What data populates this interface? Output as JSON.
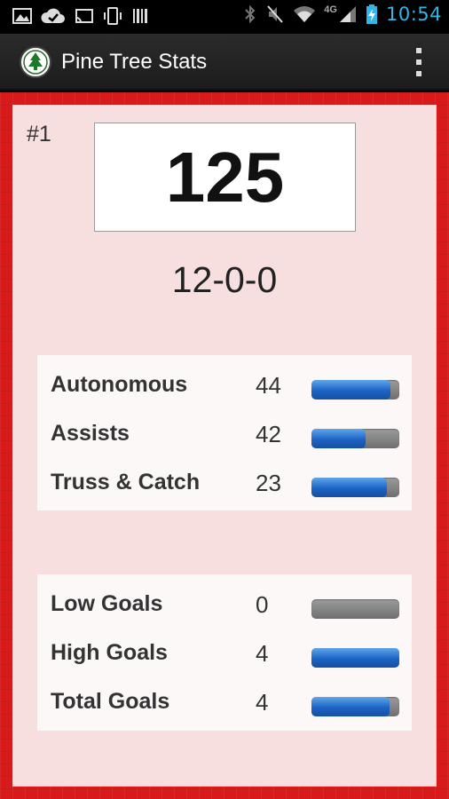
{
  "status_bar": {
    "time": "10:54",
    "network_label": "4G"
  },
  "app": {
    "title": "Pine Tree Stats"
  },
  "team": {
    "rank": "#1",
    "number": "125",
    "record": "12-0-0"
  },
  "stats_primary": [
    {
      "label": "Autonomous",
      "value": "44",
      "fill_fraction": 0.9
    },
    {
      "label": "Assists",
      "value": "42",
      "fill_fraction": 0.62
    },
    {
      "label": "Truss & Catch",
      "value": "23",
      "fill_fraction": 0.86
    }
  ],
  "stats_goals": [
    {
      "label": "Low Goals",
      "value": "0",
      "fill_fraction": 0.0
    },
    {
      "label": "High Goals",
      "value": "4",
      "fill_fraction": 1.0
    },
    {
      "label": "Total Goals",
      "value": "4",
      "fill_fraction": 0.89
    }
  ],
  "colors": {
    "accent_blue": "#1d63c4",
    "background_red": "#d81a1a",
    "card_pink": "#f7dfe0",
    "clock_blue": "#33b5e5"
  }
}
